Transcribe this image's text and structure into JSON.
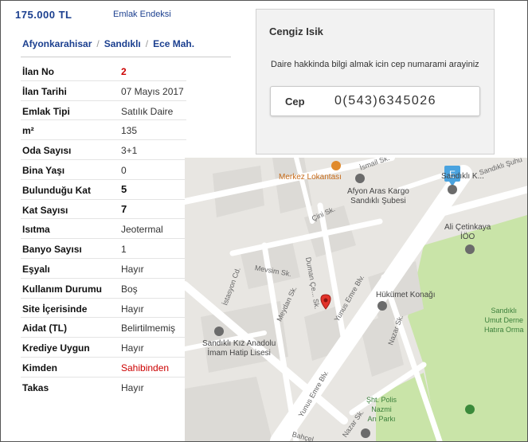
{
  "header": {
    "price": "175.000 TL",
    "index_link": "Emlak Endeksi"
  },
  "breadcrumb": [
    "Afyonkarahisar",
    "Sandıklı",
    "Ece Mah."
  ],
  "breadcrumb_sep": "/",
  "details": [
    {
      "key": "İlan No",
      "value": "2"
    },
    {
      "key": "İlan Tarihi",
      "value": "07 Mayıs 2017"
    },
    {
      "key": "Emlak Tipi",
      "value": "Satılık Daire"
    },
    {
      "key": "m²",
      "value": "135"
    },
    {
      "key": "Oda Sayısı",
      "value": "3+1"
    },
    {
      "key": "Bina Yaşı",
      "value": "0"
    },
    {
      "key": "Bulunduğu Kat",
      "value": "5"
    },
    {
      "key": "Kat Sayısı",
      "value": "7"
    },
    {
      "key": "Isıtma",
      "value": "Jeotermal"
    },
    {
      "key": "Banyo Sayısı",
      "value": "1"
    },
    {
      "key": "Eşyalı",
      "value": "Hayır"
    },
    {
      "key": "Kullanım Durumu",
      "value": "Boş"
    },
    {
      "key": "Site İçerisinde",
      "value": "Hayır"
    },
    {
      "key": "Aidat (TL)",
      "value": "Belirtilmemiş"
    },
    {
      "key": "Krediye Uygun",
      "value": "Hayır"
    },
    {
      "key": "Kimden",
      "value": "Sahibinden"
    },
    {
      "key": "Takas",
      "value": "Hayır"
    }
  ],
  "contact": {
    "name": "Cengiz Isik",
    "message": "Daire hakkinda bilgi almak icin cep numarami arayiniz",
    "phone_label": "Cep",
    "phone_number": "0(543)6345026"
  },
  "map": {
    "pois": {
      "merkez": "Merkez Lokantası",
      "afyon_aras": "Afyon Aras Kargo\nSandıklı Şubesi",
      "sandikli_k": "Sandıklı K...",
      "ali": "Ali Çetinkaya\nİÖO",
      "hukumet": "Hükümet Konağı",
      "kiz_lisesi": "Sandıklı Kız Anadolu\nİmam Hatip Lisesi",
      "polis": "Şht. Polis\nNazmi\nArı Parkı",
      "umut": "Sandıklı\nUmut Derne\nHatıra Orma"
    },
    "streets": {
      "ismail": "İsmail Sk.",
      "sandikli_suh": "Sandıklı Şuhu",
      "cini": "Çini Sk.",
      "mevsim": "Mevsim Sk.",
      "istasyon": "İstasyon Cd.",
      "meydan": "Meydan Sk.",
      "duman": "Duman Çe... Sk.",
      "yunus1": "Yunus Emre Blv.",
      "yunus2": "Yunus Emre Blv.",
      "nazar1": "Nazar Sk.",
      "nazar2": "Nazar Sk.",
      "bahce": "Bahçel..."
    },
    "marker_letter": "E",
    "colors": {
      "pin": "#e2332a",
      "park": "#c7e3a4",
      "road": "#ffffff",
      "block": "#dcdad6",
      "marker": "#4aa3df"
    }
  }
}
